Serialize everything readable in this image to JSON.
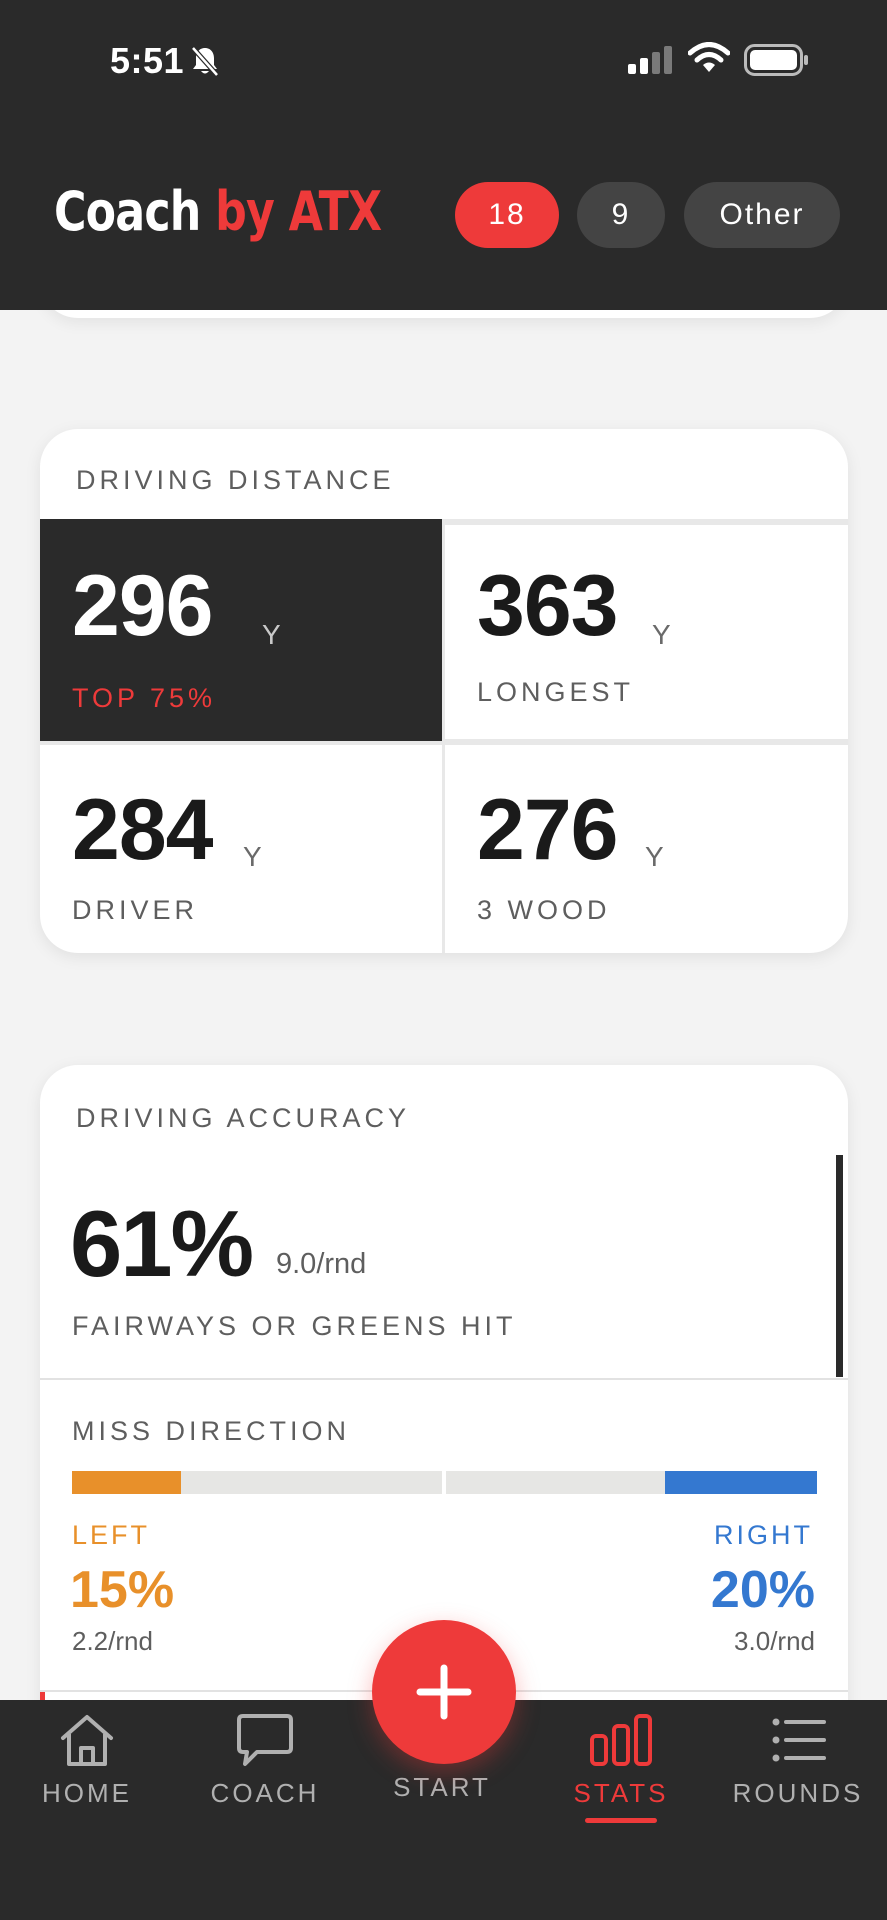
{
  "status_bar": {
    "time": "5:51"
  },
  "header": {
    "logo_primary": "Coach",
    "logo_accent": "by ATX",
    "filters": [
      {
        "label": "18",
        "selected": true
      },
      {
        "label": "9",
        "selected": false
      },
      {
        "label": "Other",
        "selected": false
      }
    ]
  },
  "driving_distance": {
    "title": "DRIVING DISTANCE",
    "stats": [
      {
        "value": "296",
        "unit": "Y",
        "label": "TOP 75%"
      },
      {
        "value": "363",
        "unit": "Y",
        "label": "LONGEST"
      },
      {
        "value": "284",
        "unit": "Y",
        "label": "DRIVER"
      },
      {
        "value": "276",
        "unit": "Y",
        "label": "3 WOOD"
      }
    ]
  },
  "driving_accuracy": {
    "title": "DRIVING ACCURACY",
    "percent": "61%",
    "per_round": "9.0/rnd",
    "label": "FAIRWAYS OR GREENS HIT",
    "miss_direction": {
      "title": "MISS DIRECTION",
      "left": {
        "label": "LEFT",
        "percent": "15%",
        "per_round": "2.2/rnd",
        "fraction": 0.15
      },
      "right": {
        "label": "RIGHT",
        "percent": "20%",
        "per_round": "3.0/rnd",
        "fraction": 0.2
      }
    }
  },
  "colors": {
    "accent": "#ee3a3a",
    "left": "#e8902a",
    "right": "#3478d0",
    "dark": "#2a2a2a"
  },
  "nav": {
    "items": [
      {
        "label": "HOME",
        "icon": "home-icon"
      },
      {
        "label": "COACH",
        "icon": "chat-icon"
      },
      {
        "label": "START",
        "icon": "plus-icon"
      },
      {
        "label": "STATS",
        "icon": "bar-chart-icon",
        "active": true
      },
      {
        "label": "ROUNDS",
        "icon": "list-icon"
      }
    ]
  }
}
